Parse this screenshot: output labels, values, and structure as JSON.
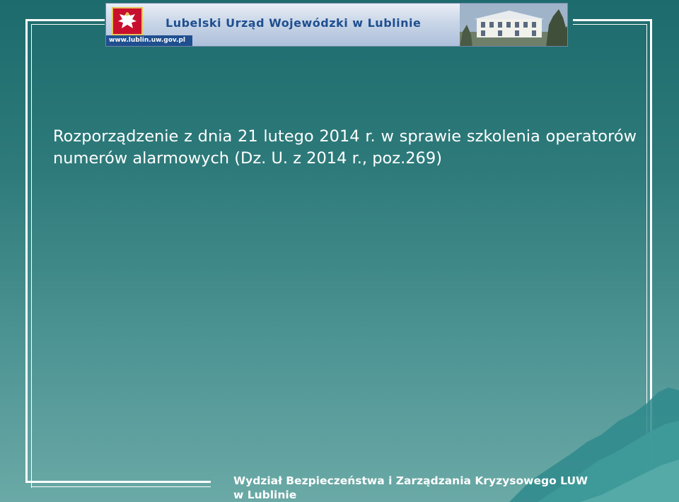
{
  "header": {
    "title": "Lubelski Urząd Wojewódzki w Lublinie",
    "url": "www.lublin.uw.gov.pl",
    "emblem_icon": "polish-eagle-icon"
  },
  "slide": {
    "heading_main": "Rozporządzenie z dnia 21 lutego 2014 r. w sprawie szkolenia operatorów numerów alarmowych (Dz. U. z 2014 r., poz.269",
    "heading_close": ")"
  },
  "footer": {
    "line1": "Wydział Bezpieczeństwa i Zarządzania Kryzysowego LUW",
    "line2": "w Lublinie"
  },
  "colors": {
    "background_top": "#1d6b6d",
    "background_bottom": "#6aa9a6",
    "frame": "#ffffff",
    "banner_text": "#1f4f8f",
    "emblem_red": "#c8102e"
  }
}
